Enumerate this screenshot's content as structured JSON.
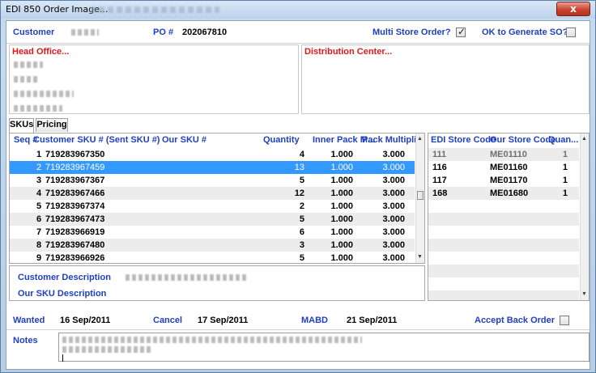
{
  "window": {
    "title": "EDI 850 Order Image...",
    "close_label": "x"
  },
  "header": {
    "customer_label": "Customer",
    "po_label": "PO #",
    "po_value": "202067810",
    "multi_store_label": "Multi Store Order?",
    "multi_store_checked": true,
    "ok_generate_label": "OK to Generate SO?",
    "ok_generate_checked": false
  },
  "head_office": {
    "title": "Head Office..."
  },
  "distribution_center": {
    "title": "Distribution Center..."
  },
  "tabs": [
    {
      "label": "SKUs",
      "active": true
    },
    {
      "label": "Pricing",
      "active": false
    }
  ],
  "skus_grid": {
    "columns": [
      "Seq #",
      "Customer SKU # (Sent SKU #)",
      "Our SKU #",
      "Quantity",
      "Inner Pack M...",
      "Pack Multipli..."
    ],
    "rows": [
      {
        "seq": "1",
        "customer_sku": "719283967350",
        "our_sku": "",
        "quantity": "4",
        "inner_pack": "1.000",
        "pack_mult": "3.000"
      },
      {
        "seq": "2",
        "customer_sku": "719283967459",
        "our_sku": "",
        "quantity": "13",
        "inner_pack": "1.000",
        "pack_mult": "3.000"
      },
      {
        "seq": "3",
        "customer_sku": "719283967367",
        "our_sku": "",
        "quantity": "5",
        "inner_pack": "1.000",
        "pack_mult": "3.000"
      },
      {
        "seq": "4",
        "customer_sku": "719283967466",
        "our_sku": "",
        "quantity": "12",
        "inner_pack": "1.000",
        "pack_mult": "3.000"
      },
      {
        "seq": "5",
        "customer_sku": "719283967374",
        "our_sku": "",
        "quantity": "2",
        "inner_pack": "1.000",
        "pack_mult": "3.000"
      },
      {
        "seq": "6",
        "customer_sku": "719283967473",
        "our_sku": "",
        "quantity": "5",
        "inner_pack": "1.000",
        "pack_mult": "3.000"
      },
      {
        "seq": "7",
        "customer_sku": "719283966919",
        "our_sku": "",
        "quantity": "6",
        "inner_pack": "1.000",
        "pack_mult": "3.000"
      },
      {
        "seq": "8",
        "customer_sku": "719283967480",
        "our_sku": "",
        "quantity": "3",
        "inner_pack": "1.000",
        "pack_mult": "3.000"
      },
      {
        "seq": "9",
        "customer_sku": "719283966926",
        "our_sku": "",
        "quantity": "5",
        "inner_pack": "1.000",
        "pack_mult": "3.000"
      }
    ],
    "selected_seq": "2"
  },
  "descriptions": {
    "customer_description_label": "Customer Description",
    "our_sku_description_label": "Our SKU Description"
  },
  "stores_grid": {
    "columns": [
      "EDI Store Code",
      "Our Store Code",
      "Quan..."
    ],
    "rows": [
      {
        "edi_code": "111",
        "our_code": "ME01110",
        "quantity": "1",
        "muted": true
      },
      {
        "edi_code": "116",
        "our_code": "ME01160",
        "quantity": "1",
        "muted": false
      },
      {
        "edi_code": "117",
        "our_code": "ME01170",
        "quantity": "1",
        "muted": false
      },
      {
        "edi_code": "168",
        "our_code": "ME01680",
        "quantity": "1",
        "muted": false
      }
    ]
  },
  "dates": {
    "wanted_label": "Wanted",
    "wanted_value": "16 Sep/2011",
    "cancel_label": "Cancel",
    "cancel_value": "17 Sep/2011",
    "mabd_label": "MABD",
    "mabd_value": "21 Sep/2011",
    "accept_back_order_label": "Accept Back Order",
    "accept_back_order_checked": false
  },
  "notes": {
    "label": "Notes"
  },
  "colors": {
    "label_blue": "#1f3fbf",
    "address_red": "#e4161b",
    "selection": "#3399ff",
    "alt_row": "#ececec"
  }
}
